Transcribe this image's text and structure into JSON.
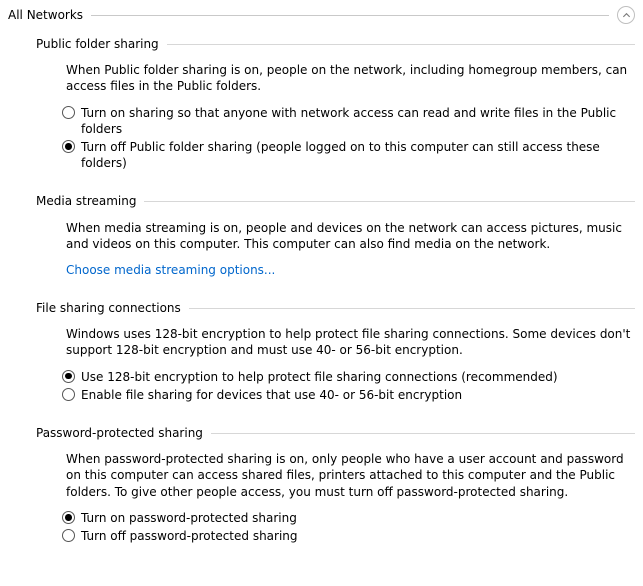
{
  "group": {
    "title": "All Networks"
  },
  "public_sharing": {
    "title": "Public folder sharing",
    "desc": "When Public folder sharing is on, people on the network, including homegroup members, can access files in the Public folders.",
    "opt_on": "Turn on sharing so that anyone with network access can read and write files in the Public folders",
    "opt_off": "Turn off Public folder sharing (people logged on to this computer can still access these folders)",
    "selected": "off"
  },
  "media_streaming": {
    "title": "Media streaming",
    "desc": "When media streaming is on, people and devices on the network can access pictures, music and videos on this computer. This computer can also find media on the network.",
    "link": "Choose media streaming options..."
  },
  "file_sharing": {
    "title": "File sharing connections",
    "desc": "Windows uses 128-bit encryption to help protect file sharing connections. Some devices don't support 128-bit encryption and must use 40- or 56-bit encryption.",
    "opt_128": "Use 128-bit encryption to help protect file sharing connections (recommended)",
    "opt_4056": "Enable file sharing for devices that use 40- or 56-bit encryption",
    "selected": "128"
  },
  "password_sharing": {
    "title": "Password-protected sharing",
    "desc": "When password-protected sharing is on, only people who have a user account and password on this computer can access shared files, printers attached to this computer and the Public folders. To give other people access, you must turn off password-protected sharing.",
    "opt_on": "Turn on password-protected sharing",
    "opt_off": "Turn off password-protected sharing",
    "selected": "on"
  }
}
